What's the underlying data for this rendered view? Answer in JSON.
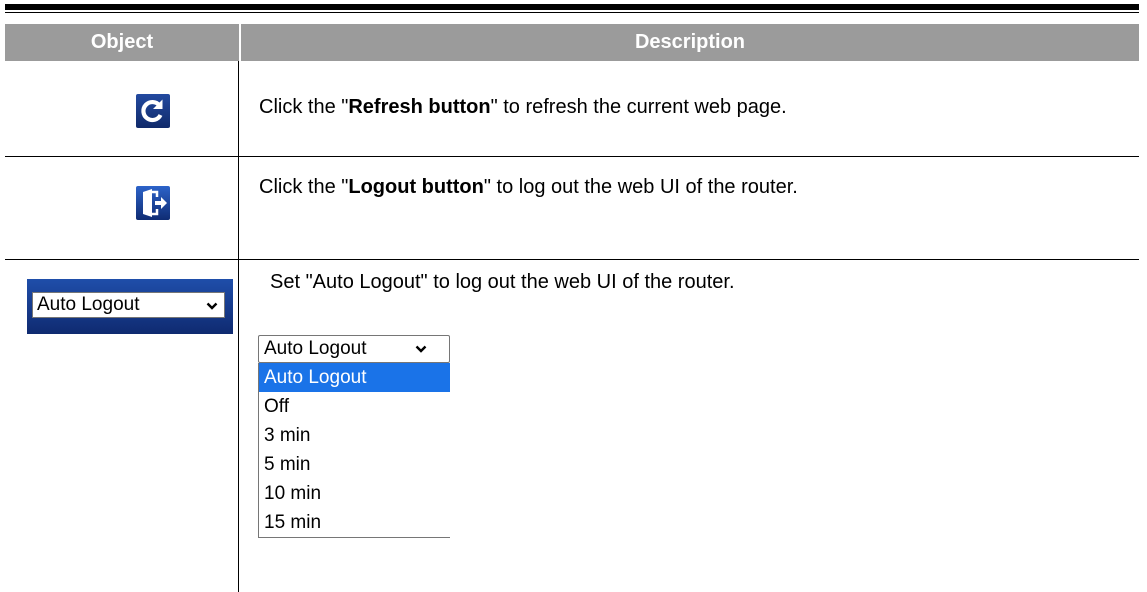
{
  "header": {
    "object": "Object",
    "description": "Description"
  },
  "rows": [
    {
      "icon": "refresh-icon",
      "prefix": "Click the \"",
      "bold": "Refresh button",
      "suffix": "\" to refresh the current web page."
    },
    {
      "icon": "logout-icon",
      "prefix": "Click the \"",
      "bold": "Logout button",
      "suffix": "\" to log out the web UI of the router."
    },
    {
      "icon": "auto-logout-select",
      "select_label": "Auto Logout",
      "text": "Set \"Auto Logout\" to log out the web UI of the router."
    }
  ],
  "dropdown": {
    "selected": "Auto Logout",
    "options": [
      "Auto Logout",
      "Off",
      "3 min",
      "5 min",
      "10 min",
      "15 min"
    ],
    "highlight_color": "#1a73e8"
  },
  "colors": {
    "header_bg": "#9b9b9b",
    "icon_blue": "#1f4eaa"
  }
}
